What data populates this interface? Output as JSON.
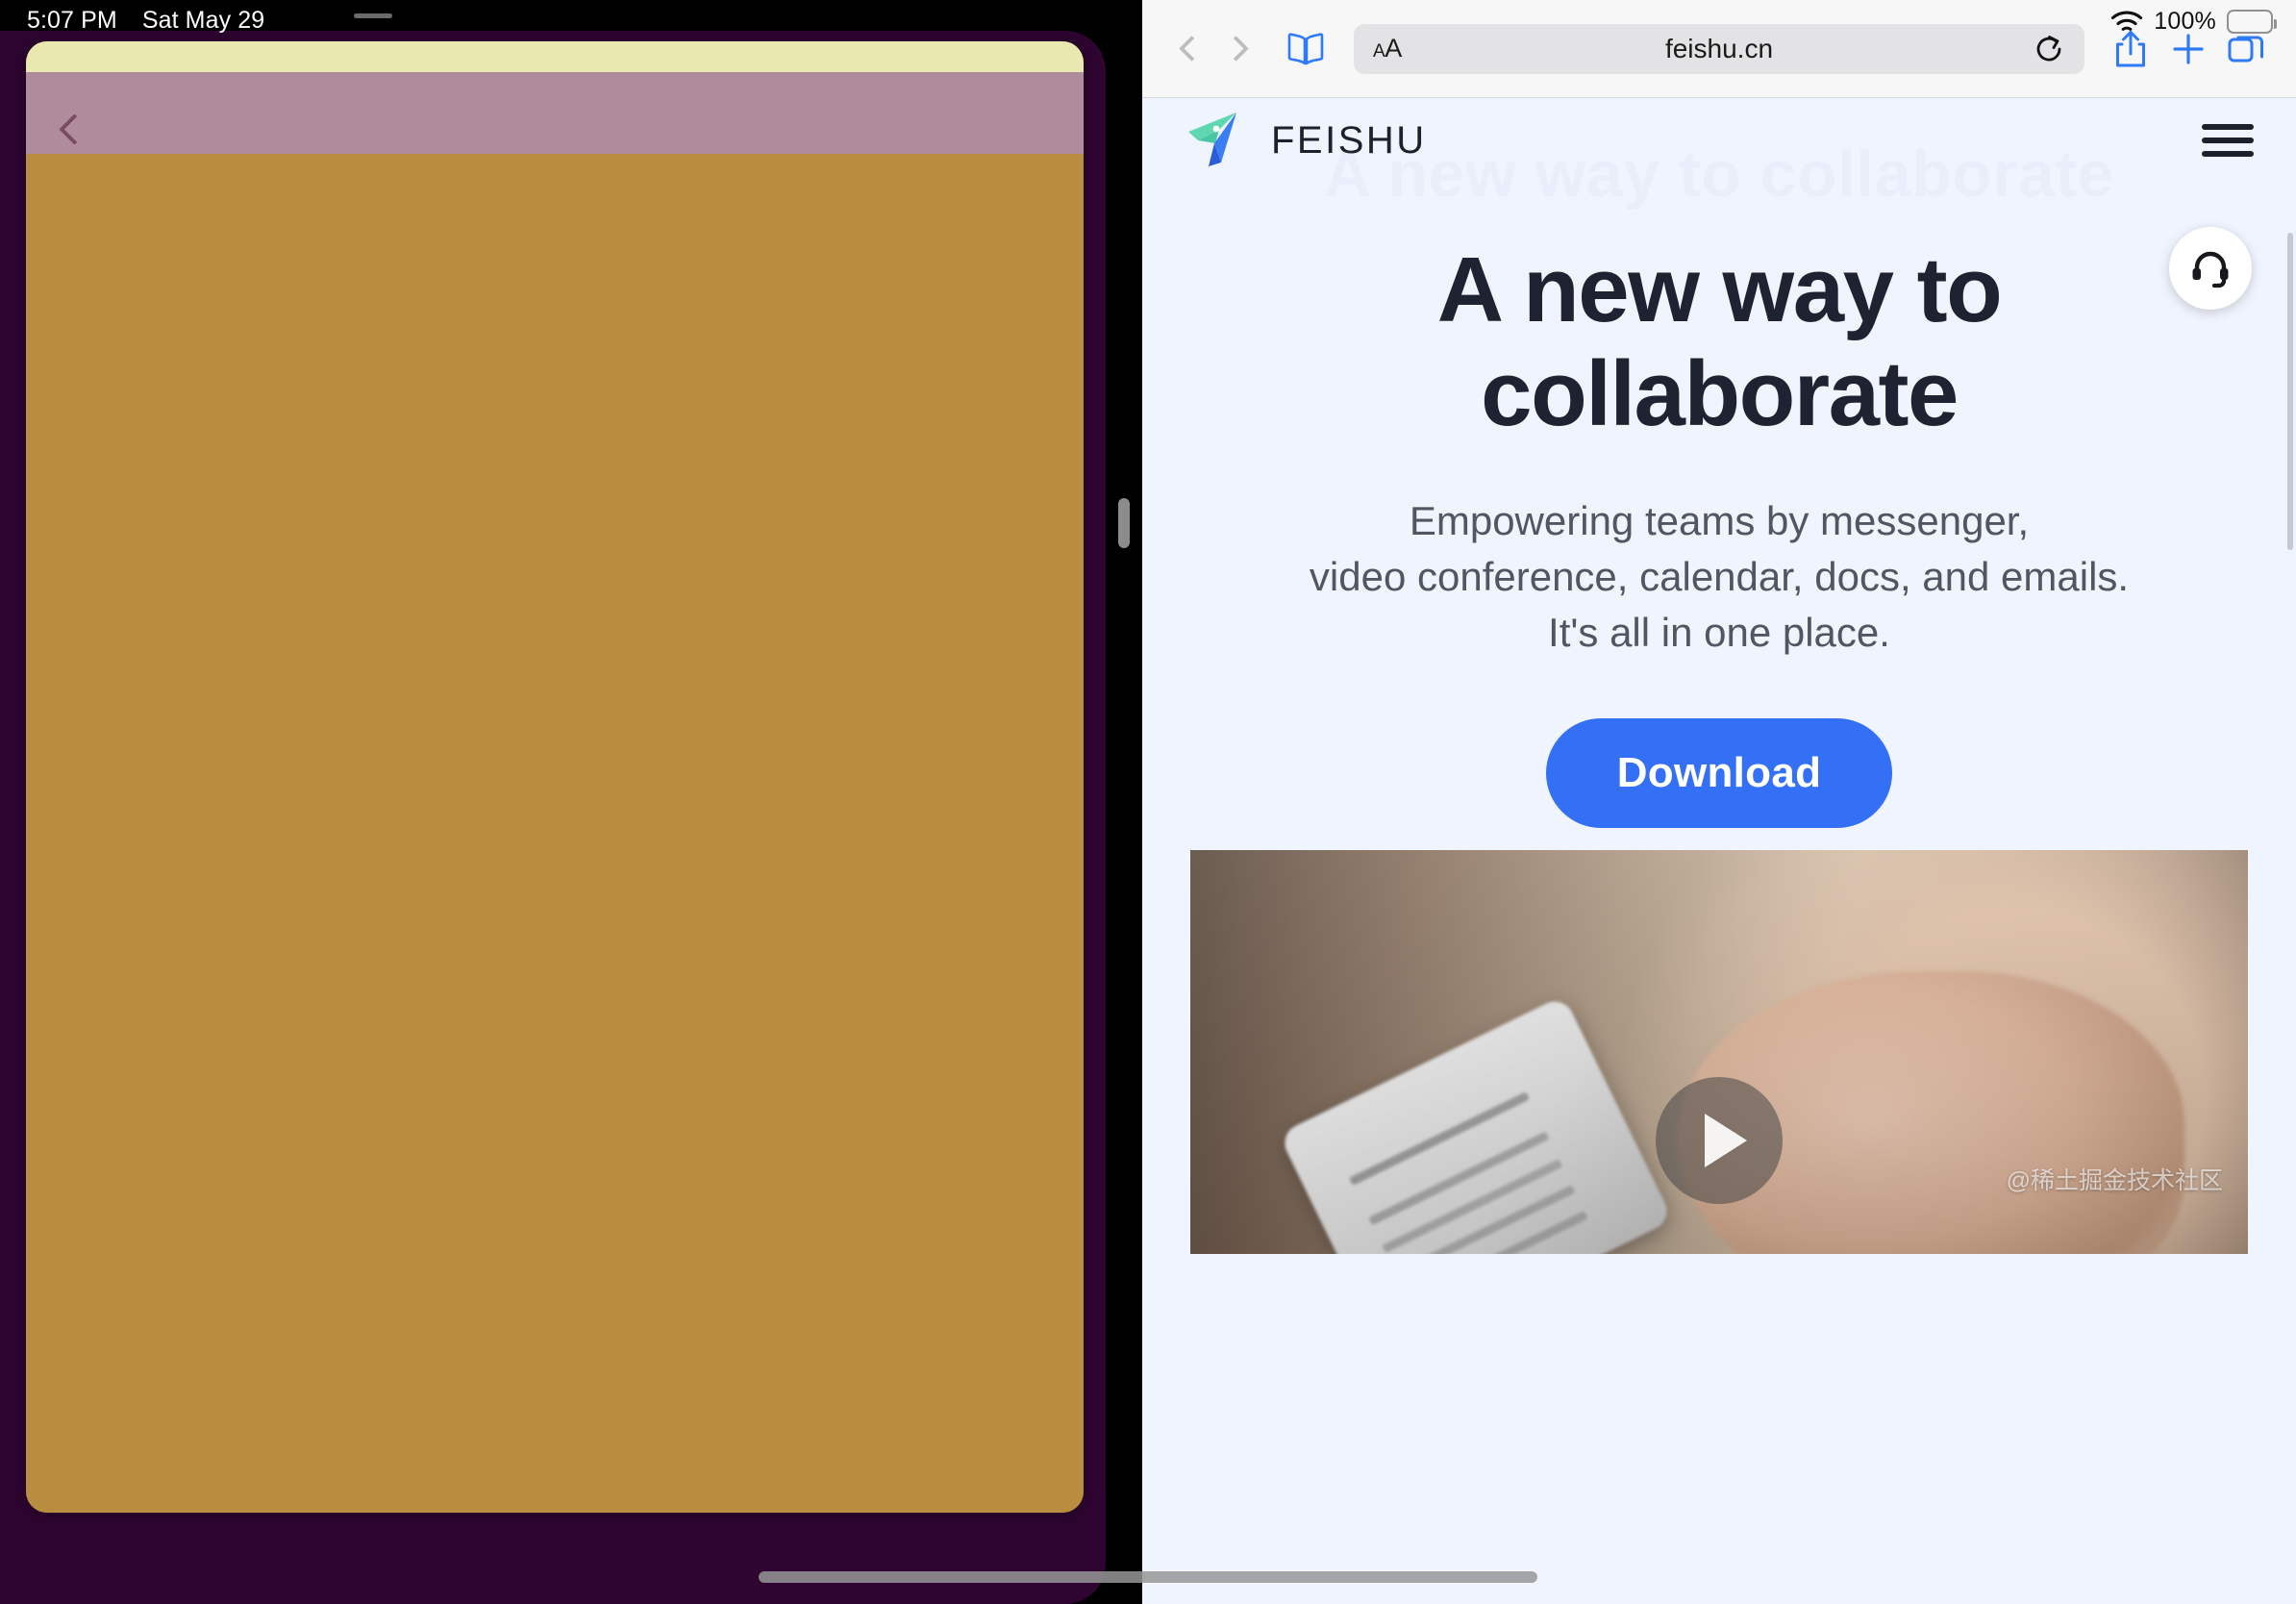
{
  "status_bar": {
    "time": "5:07 PM",
    "date": "Sat May 29",
    "battery_percent": "100%",
    "wifi_icon": "wifi-icon",
    "battery_icon": "battery-full-icon"
  },
  "left_app": {
    "back_icon": "chevron-left-icon",
    "colors": {
      "device_frame": "#2D0530",
      "top_strip": "#E9E8B0",
      "header": "#B08B9C",
      "body": "#B98D40"
    }
  },
  "split_view": {
    "divider_handle": "split-view-grabber"
  },
  "safari": {
    "back_icon": "chevron-left-icon",
    "forward_icon": "chevron-right-icon",
    "bookmarks_icon": "book-icon",
    "page_settings_label_small": "A",
    "page_settings_label_large": "A",
    "url": "feishu.cn",
    "reload_icon": "reload-icon",
    "share_icon": "share-icon",
    "new_tab_icon": "plus-icon",
    "tabs_icon": "tabs-icon",
    "accent_color": "#3478F6"
  },
  "page": {
    "background_color": "#F0F4FE",
    "brand_name": "FEISHU",
    "logo_icon": "feishu-paper-plane-logo",
    "menu_icon": "hamburger-menu-icon",
    "ghost_text": "A new way to collaborate",
    "headline_line1": "A new way to",
    "headline_line2": "collaborate",
    "subtitle_line1": "Empowering teams by messenger,",
    "subtitle_line2": "video conference, calendar, docs, and emails.",
    "subtitle_line3": "It's all in one place.",
    "download_label": "Download",
    "download_color": "#3370F5",
    "headline_color": "#1F2230",
    "subtitle_color": "#51565F",
    "support_icon": "headset-icon",
    "play_icon": "play-button-icon",
    "watermark": "@稀土掘金技术社区"
  }
}
